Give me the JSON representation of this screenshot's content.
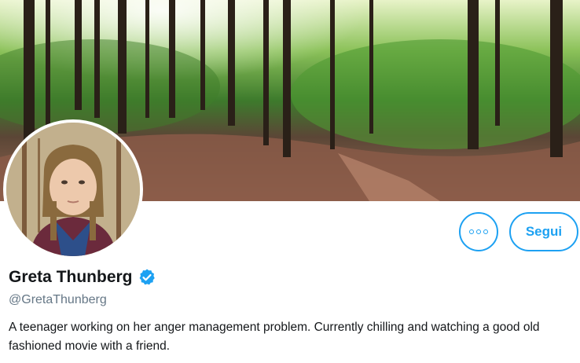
{
  "profile": {
    "name": "Greta Thunberg",
    "handle": "@GretaThunberg",
    "verified": true,
    "bio": "A teenager working on her anger management problem. Currently chilling and watching a good old fashioned movie with a friend."
  },
  "actions": {
    "more_icon": "more-options-icon",
    "follow_label": "Segui"
  },
  "colors": {
    "accent": "#1da1f2",
    "name_text": "#14171a",
    "handle_text": "#657786"
  }
}
